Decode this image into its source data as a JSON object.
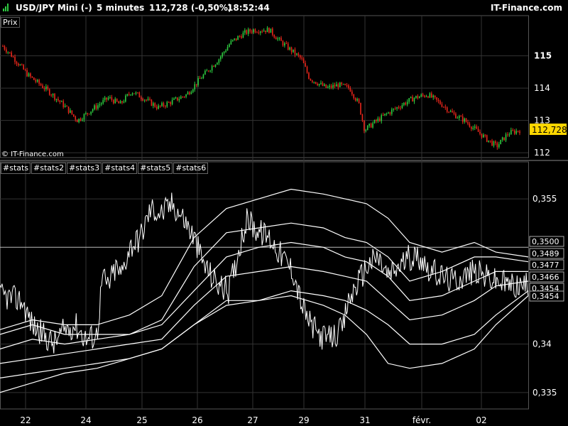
{
  "header": {
    "instrument": "USD/JPY Mini (-)",
    "timeframe": "5 minutes",
    "price": "112,728 (-0,50%)",
    "time": "18:52:44",
    "brand": "IT-Finance.com"
  },
  "price_panel": {
    "label": "Prix",
    "watermark": "© IT-Finance.com",
    "last_price": "112,728",
    "last_price_color": "#ffd700",
    "up_color": "#2ecc40",
    "down_color": "#e8261b"
  },
  "indicator_tabs": [
    "#stats",
    "#stats2",
    "#stats3",
    "#stats4",
    "#stats5",
    "#stats6"
  ],
  "x_tick_labels": [
    "22",
    "24",
    "25",
    "26",
    "27",
    "29",
    "31",
    "févr.",
    "02"
  ],
  "chart_data": [
    {
      "type": "candlestick",
      "y_ticks": [
        "115",
        "114",
        "113",
        "112"
      ],
      "ylim": [
        111.85,
        116.2
      ],
      "last_value": 112.728,
      "close_path": [
        [
          0,
          115.3
        ],
        [
          8,
          115.0
        ],
        [
          22,
          114.4
        ],
        [
          40,
          113.9
        ],
        [
          55,
          113.4
        ],
        [
          65,
          113.0
        ],
        [
          80,
          113.4
        ],
        [
          92,
          113.7
        ],
        [
          102,
          113.5
        ],
        [
          112,
          113.9
        ],
        [
          122,
          113.7
        ],
        [
          135,
          113.4
        ],
        [
          148,
          113.6
        ],
        [
          160,
          113.8
        ],
        [
          172,
          114.3
        ],
        [
          180,
          114.6
        ],
        [
          188,
          114.9
        ],
        [
          198,
          115.4
        ],
        [
          210,
          115.7
        ],
        [
          218,
          115.8
        ],
        [
          232,
          115.8
        ],
        [
          240,
          115.5
        ],
        [
          250,
          115.2
        ],
        [
          260,
          114.9
        ],
        [
          267,
          114.3
        ],
        [
          282,
          114.0
        ],
        [
          292,
          114.1
        ],
        [
          302,
          114.0
        ],
        [
          310,
          113.5
        ],
        [
          315,
          112.7
        ],
        [
          322,
          112.9
        ],
        [
          334,
          113.2
        ],
        [
          348,
          113.5
        ],
        [
          358,
          113.7
        ],
        [
          370,
          113.8
        ],
        [
          382,
          113.5
        ],
        [
          392,
          113.2
        ],
        [
          402,
          113.0
        ],
        [
          412,
          112.7
        ],
        [
          422,
          112.4
        ],
        [
          430,
          112.2
        ],
        [
          440,
          112.6
        ],
        [
          450,
          112.7
        ]
      ]
    },
    {
      "type": "line",
      "y_ticks": [
        "0,355",
        "0,34",
        "0,335"
      ],
      "ylim": [
        0.3333,
        0.3575
      ],
      "series": [
        {
          "values": [
            [
              0,
              0.3415
            ],
            [
              30,
              0.3425
            ],
            [
              60,
              0.342
            ],
            [
              90,
              0.342
            ],
            [
              120,
              0.343
            ],
            [
              150,
              0.345
            ],
            [
              180,
              0.351
            ],
            [
              210,
              0.354
            ],
            [
              240,
              0.355
            ],
            [
              270,
              0.356
            ],
            [
              300,
              0.3555
            ],
            [
              320,
              0.355
            ],
            [
              340,
              0.3545
            ],
            [
              360,
              0.353
            ],
            [
              380,
              0.3505
            ],
            [
              410,
              0.3495
            ],
            [
              440,
              0.3505
            ],
            [
              460,
              0.3495
            ],
            [
              490,
              0.349
            ]
          ]
        },
        {
          "values": [
            [
              0,
              0.341
            ],
            [
              30,
              0.342
            ],
            [
              60,
              0.341
            ],
            [
              90,
              0.341
            ],
            [
              120,
              0.341
            ],
            [
              150,
              0.3425
            ],
            [
              180,
              0.348
            ],
            [
              210,
              0.3515
            ],
            [
              240,
              0.352
            ],
            [
              270,
              0.3525
            ],
            [
              300,
              0.352
            ],
            [
              320,
              0.351
            ],
            [
              340,
              0.3505
            ],
            [
              360,
              0.349
            ],
            [
              380,
              0.3465
            ],
            [
              410,
              0.3475
            ],
            [
              440,
              0.349
            ],
            [
              460,
              0.349
            ],
            [
              490,
              0.3485
            ]
          ]
        },
        {
          "values": [
            [
              0,
              0.3395
            ],
            [
              30,
              0.3405
            ],
            [
              60,
              0.34
            ],
            [
              90,
              0.3405
            ],
            [
              120,
              0.341
            ],
            [
              150,
              0.342
            ],
            [
              180,
              0.3455
            ],
            [
              210,
              0.349
            ],
            [
              240,
              0.35
            ],
            [
              270,
              0.3505
            ],
            [
              300,
              0.35
            ],
            [
              320,
              0.349
            ],
            [
              340,
              0.3485
            ],
            [
              360,
              0.347
            ],
            [
              380,
              0.3445
            ],
            [
              410,
              0.345
            ],
            [
              440,
              0.3465
            ],
            [
              460,
              0.3475
            ],
            [
              490,
              0.3475
            ]
          ]
        },
        {
          "values": [
            [
              0,
              0.338
            ],
            [
              30,
              0.3385
            ],
            [
              60,
              0.339
            ],
            [
              90,
              0.3395
            ],
            [
              120,
              0.34
            ],
            [
              150,
              0.3405
            ],
            [
              180,
              0.344
            ],
            [
              210,
              0.347
            ],
            [
              240,
              0.3475
            ],
            [
              270,
              0.348
            ],
            [
              300,
              0.3475
            ],
            [
              320,
              0.347
            ],
            [
              340,
              0.3465
            ],
            [
              360,
              0.3445
            ],
            [
              380,
              0.3425
            ],
            [
              410,
              0.343
            ],
            [
              440,
              0.3445
            ],
            [
              460,
              0.346
            ],
            [
              490,
              0.3465
            ]
          ]
        },
        {
          "values": [
            [
              0,
              0.3365
            ],
            [
              30,
              0.337
            ],
            [
              60,
              0.3375
            ],
            [
              90,
              0.338
            ],
            [
              120,
              0.3385
            ],
            [
              150,
              0.3395
            ],
            [
              180,
              0.342
            ],
            [
              210,
              0.3445
            ],
            [
              240,
              0.3445
            ],
            [
              270,
              0.3455
            ],
            [
              300,
              0.345
            ],
            [
              320,
              0.3445
            ],
            [
              340,
              0.3435
            ],
            [
              360,
              0.342
            ],
            [
              380,
              0.34
            ],
            [
              410,
              0.34
            ],
            [
              440,
              0.341
            ],
            [
              460,
              0.343
            ],
            [
              490,
              0.3455
            ]
          ]
        },
        {
          "values": [
            [
              0,
              0.335
            ],
            [
              30,
              0.336
            ],
            [
              60,
              0.337
            ],
            [
              90,
              0.3375
            ],
            [
              120,
              0.3385
            ],
            [
              150,
              0.3395
            ],
            [
              180,
              0.342
            ],
            [
              210,
              0.344
            ],
            [
              240,
              0.3445
            ],
            [
              270,
              0.345
            ],
            [
              300,
              0.344
            ],
            [
              320,
              0.343
            ],
            [
              340,
              0.341
            ],
            [
              360,
              0.338
            ],
            [
              380,
              0.3375
            ],
            [
              410,
              0.338
            ],
            [
              440,
              0.3395
            ],
            [
              460,
              0.342
            ],
            [
              490,
              0.345
            ]
          ]
        }
      ],
      "value_labels": [
        "0,3500",
        "0,3489",
        "0,3477",
        "0,3466",
        "0,3454",
        "0,3454"
      ],
      "price_path": [
        [
          0,
          0.345
        ],
        [
          20,
          0.3445
        ],
        [
          30,
          0.342
        ],
        [
          40,
          0.341
        ],
        [
          50,
          0.34
        ],
        [
          60,
          0.3415
        ],
        [
          70,
          0.342
        ],
        [
          80,
          0.3405
        ],
        [
          90,
          0.341
        ],
        [
          95,
          0.347
        ],
        [
          100,
          0.346
        ],
        [
          108,
          0.348
        ],
        [
          112,
          0.347
        ],
        [
          120,
          0.35
        ],
        [
          130,
          0.351
        ],
        [
          140,
          0.354
        ],
        [
          150,
          0.3535
        ],
        [
          160,
          0.3545
        ],
        [
          170,
          0.353
        ],
        [
          180,
          0.351
        ],
        [
          188,
          0.3485
        ],
        [
          196,
          0.347
        ],
        [
          204,
          0.346
        ],
        [
          212,
          0.3455
        ],
        [
          218,
          0.348
        ],
        [
          224,
          0.351
        ],
        [
          230,
          0.353
        ],
        [
          236,
          0.352
        ],
        [
          242,
          0.3515
        ],
        [
          250,
          0.351
        ],
        [
          262,
          0.349
        ],
        [
          272,
          0.3475
        ],
        [
          280,
          0.344
        ],
        [
          288,
          0.342
        ],
        [
          296,
          0.341
        ],
        [
          304,
          0.3405
        ],
        [
          312,
          0.341
        ],
        [
          318,
          0.3415
        ],
        [
          322,
          0.344
        ],
        [
          330,
          0.346
        ],
        [
          340,
          0.348
        ],
        [
          350,
          0.349
        ],
        [
          360,
          0.347
        ],
        [
          370,
          0.348
        ],
        [
          380,
          0.349
        ],
        [
          390,
          0.349
        ],
        [
          400,
          0.3475
        ],
        [
          410,
          0.347
        ],
        [
          420,
          0.3465
        ],
        [
          430,
          0.347
        ],
        [
          440,
          0.3475
        ],
        [
          450,
          0.347
        ],
        [
          460,
          0.3465
        ],
        [
          470,
          0.3462
        ],
        [
          480,
          0.346
        ],
        [
          490,
          0.346
        ]
      ]
    }
  ]
}
